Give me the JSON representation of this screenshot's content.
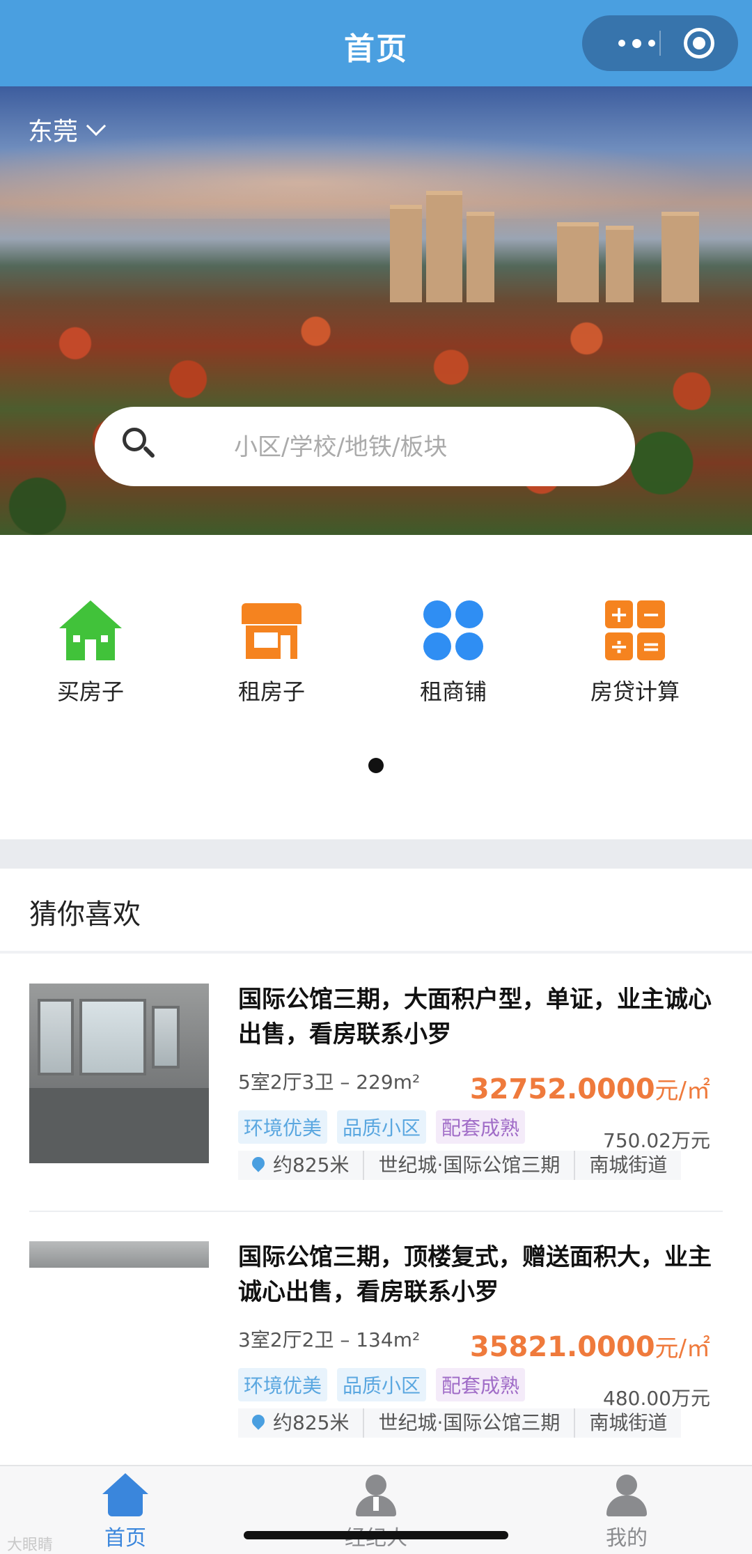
{
  "header": {
    "title": "首页"
  },
  "hero": {
    "city": "东莞",
    "search": {
      "placeholder": "小区/学校/地铁/板块"
    }
  },
  "quick_links": [
    {
      "label": "买房子",
      "icon": "house-icon",
      "color": "#41c23a"
    },
    {
      "label": "租房子",
      "icon": "shop-icon",
      "color": "#f5831f"
    },
    {
      "label": "租商铺",
      "icon": "grid-icon",
      "color": "#2f8ef3"
    },
    {
      "label": "房贷计算",
      "icon": "calculator-icon",
      "color": "#f5831f"
    }
  ],
  "recommend": {
    "title": "猜你喜欢",
    "listings": [
      {
        "title": "国际公馆三期，大面积户型，单证，业主诚心出售，看房联系小罗",
        "spec": "5室2厅3卫 – 229m²",
        "unit_price": "32752.0000",
        "unit_price_suffix": "元/㎡",
        "total": "750.02万元",
        "tags": [
          "环境优美",
          "品质小区",
          "配套成熟"
        ],
        "distance": "约825米",
        "community": "世纪城·国际公馆三期",
        "district": "南城街道"
      },
      {
        "title": "国际公馆三期，顶楼复式，赠送面积大，业主诚心出售，看房联系小罗",
        "spec": "3室2厅2卫 – 134m²",
        "unit_price": "35821.0000",
        "unit_price_suffix": "元/㎡",
        "total": "480.00万元",
        "tags": [
          "环境优美",
          "品质小区",
          "配套成熟"
        ],
        "distance": "约825米",
        "community": "世纪城·国际公馆三期",
        "district": "南城街道"
      }
    ]
  },
  "tabbar": [
    {
      "label": "首页",
      "active": true
    },
    {
      "label": "经纪人",
      "active": false
    },
    {
      "label": "我的",
      "active": false
    }
  ],
  "watermark": "大眼睛"
}
